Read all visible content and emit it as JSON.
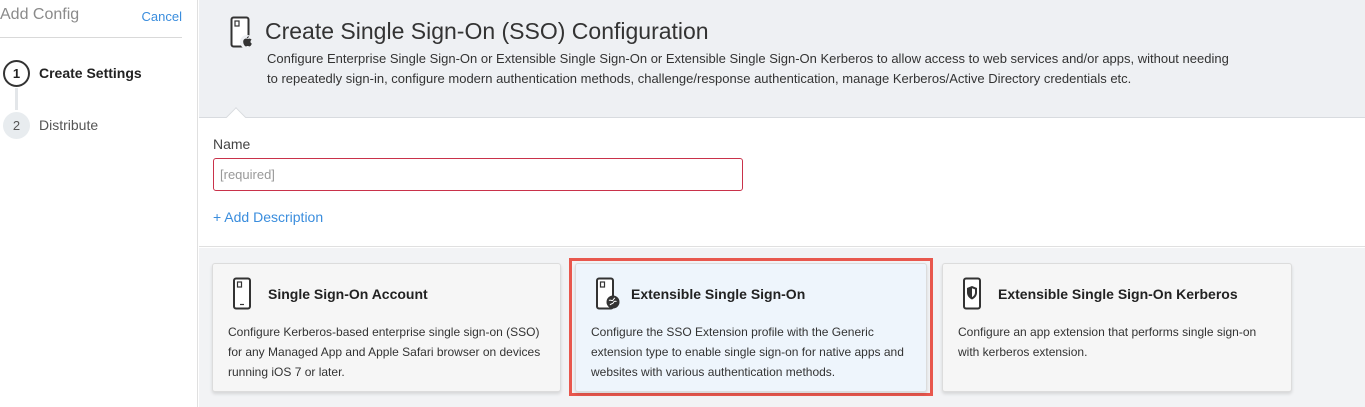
{
  "sidebar": {
    "title": "Add Config",
    "cancel_label": "Cancel",
    "steps": [
      {
        "number": "1",
        "label": "Create Settings",
        "state": "active"
      },
      {
        "number": "2",
        "label": "Distribute",
        "state": "inactive"
      }
    ]
  },
  "header": {
    "icon": "phone-apple-icon",
    "title": "Create Single Sign-On (SSO) Configuration",
    "description_line1": "Configure Enterprise Single Sign-On or Extensible Single Sign-On or Extensible Single Sign-On Kerberos to allow access to web services and/or apps, without needing",
    "description_line2": "to repeatedly sign-in, configure modern authentication methods, challenge/response authentication, manage Kerberos/Active Directory credentials etc."
  },
  "form": {
    "name_label": "Name",
    "name_placeholder": "[required]",
    "name_value": "",
    "add_description_label": "+ Add Description"
  },
  "cards": [
    {
      "icon": "phone-icon",
      "title": "Single Sign-On Account",
      "description": "Configure Kerberos-based enterprise single sign-on (SSO) for any Managed App and Apple Safari browser on devices running iOS 7 or later.",
      "selected": false
    },
    {
      "icon": "phone-globe-icon",
      "title": "Extensible Single Sign-On",
      "description": "Configure the SSO Extension profile with the Generic extension type to enable single sign-on for native apps and websites with various authentication methods.",
      "selected": true
    },
    {
      "icon": "phone-shield-icon",
      "title": "Extensible Single Sign-On Kerberos",
      "description": "Configure an app extension that performs single sign-on with kerberos extension.",
      "selected": false
    }
  ],
  "colors": {
    "accent": "#3a8ddd",
    "error_border": "#c9324a",
    "highlight": "#e8574d"
  }
}
